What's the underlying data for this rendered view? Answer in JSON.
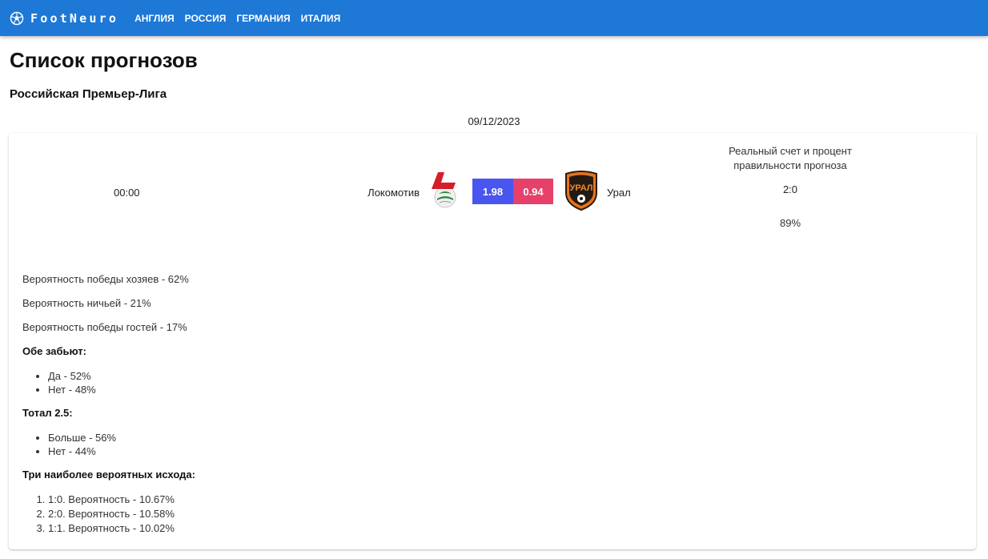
{
  "header": {
    "brand": "FootNeuro",
    "nav": [
      "АНГЛИЯ",
      "РОССИЯ",
      "ГЕРМАНИЯ",
      "ИТАЛИЯ"
    ]
  },
  "page": {
    "title": "Список прогнозов",
    "league": "Российская Премьер-Лига",
    "date": "09/12/2023"
  },
  "match": {
    "time": "00:00",
    "home_team": "Локомотив",
    "away_team": "Урал",
    "home_score": "1.98",
    "away_score": "0.94",
    "real_title": "Реальный счет и процент правильности прогноза",
    "real_score": "2:0",
    "real_percent": "89%",
    "colors": {
      "home_score_bg": "#4955ef",
      "away_score_bg": "#e6406b",
      "appbar": "#1e78d6"
    }
  },
  "details": {
    "home_win": "Вероятность победы хозяев - 62%",
    "draw": "Вероятность ничьей - 21%",
    "away_win": "Вероятность победы гостей - 17%",
    "btts_title": "Обе забьют:",
    "btts": [
      "Да - 52%",
      "Нет - 48%"
    ],
    "total_title": "Тотал 2.5:",
    "total": [
      "Больше - 56%",
      "Нет - 44%"
    ],
    "top_title": "Три наиболее вероятных исхода:",
    "top": [
      "1:0. Вероятность - 10.67%",
      "2:0. Вероятность - 10.58%",
      "1:1. Вероятность - 10.02%"
    ]
  }
}
